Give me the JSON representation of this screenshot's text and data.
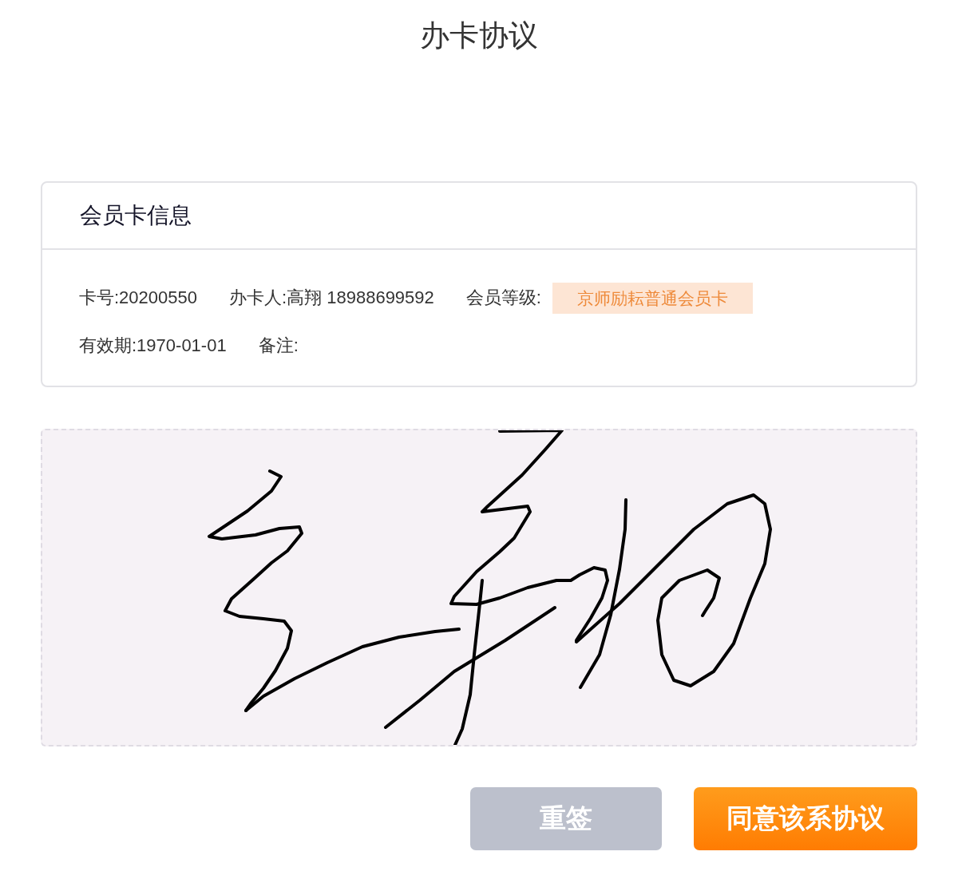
{
  "title": "办卡协议",
  "card_info": {
    "heading": "会员卡信息",
    "rows": [
      [
        {
          "kind": "text",
          "text": "卡号:20200550"
        },
        {
          "kind": "text",
          "text": "办卡人:高翔 18988699592"
        },
        {
          "kind": "tag",
          "text": "会员等级:",
          "tag": "京师励耘普通会员卡"
        }
      ],
      [
        {
          "kind": "text",
          "text": "有效期:1970-01-01"
        },
        {
          "kind": "text",
          "text": "备注:"
        }
      ]
    ]
  },
  "signature_pad": {
    "signed": true
  },
  "buttons": [
    {
      "kind": "secondary",
      "label": "重签"
    },
    {
      "kind": "primary",
      "label": "同意该系协议"
    }
  ]
}
